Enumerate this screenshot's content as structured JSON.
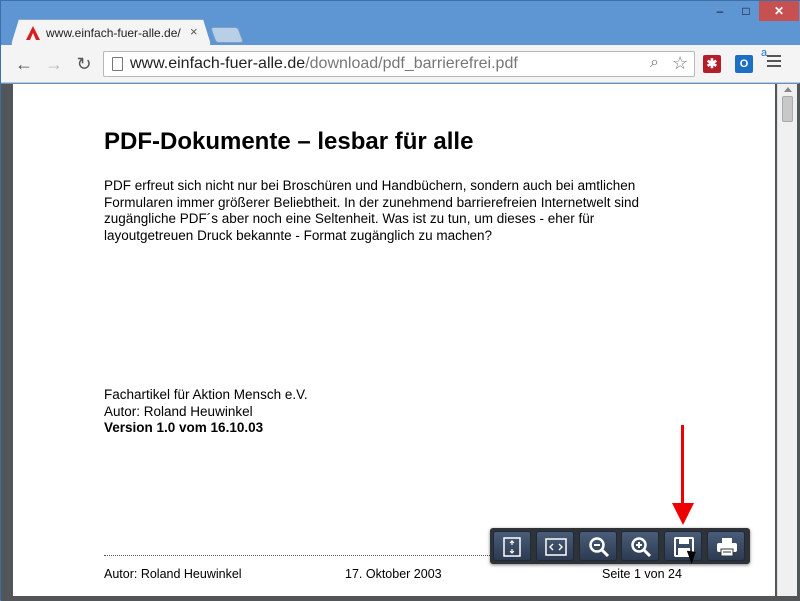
{
  "browser": {
    "tab": {
      "title": "www.einfach-fuer-alle.de/",
      "close_icon": "close-icon"
    },
    "window_controls": {
      "minimize": "–",
      "maximize": "□",
      "close": "✕"
    },
    "toolbar": {
      "back": "←",
      "forward": "→",
      "reload": "↻",
      "url_host": "www.einfach-fuer-alle.de",
      "url_path": "/download/pdf_barrierefrei.pdf",
      "zoom_icon": "zoom-icon",
      "star_icon": "star-icon",
      "ext_red": "✱",
      "ext_outlook": "O",
      "ext_outlook_sup": "a"
    }
  },
  "document": {
    "title": "PDF-Dokumente – lesbar für alle",
    "body": "PDF erfreut sich nicht nur bei Broschüren und Handbüchern, sondern auch bei amtlichen Formularen immer größerer Beliebtheit. In der zunehmend barrierefreien Internetwelt sind zugängliche PDF´s aber noch eine Seltenheit. Was ist zu tun, um dieses - eher für layoutgetreuen Druck bekannte - Format zugänglich zu machen?",
    "meta_line1": "Fachartikel für Aktion Mensch e.V.",
    "meta_line2": "Autor: Roland Heuwinkel",
    "meta_line3": "Version 1.0 vom 16.10.03",
    "footer_author": "Autor: Roland Heuwinkel",
    "footer_date": "17. Oktober 2003",
    "footer_page": "Seite 1 von 24"
  },
  "pdf_toolbar": {
    "buttons": [
      "fit-page",
      "fit-width",
      "zoom-out",
      "zoom-in",
      "save",
      "print"
    ]
  },
  "colors": {
    "accent_arrow": "#e00000",
    "toolbar_bg": "#2f3337"
  }
}
